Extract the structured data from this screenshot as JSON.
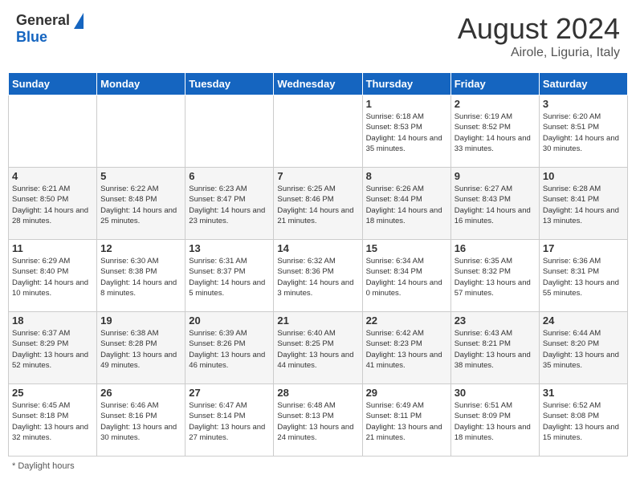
{
  "header": {
    "logo_general": "General",
    "logo_blue": "Blue",
    "month_year": "August 2024",
    "location": "Airole, Liguria, Italy"
  },
  "days_of_week": [
    "Sunday",
    "Monday",
    "Tuesday",
    "Wednesday",
    "Thursday",
    "Friday",
    "Saturday"
  ],
  "weeks": [
    [
      {
        "day": "",
        "info": ""
      },
      {
        "day": "",
        "info": ""
      },
      {
        "day": "",
        "info": ""
      },
      {
        "day": "",
        "info": ""
      },
      {
        "day": "1",
        "info": "Sunrise: 6:18 AM\nSunset: 8:53 PM\nDaylight: 14 hours and 35 minutes."
      },
      {
        "day": "2",
        "info": "Sunrise: 6:19 AM\nSunset: 8:52 PM\nDaylight: 14 hours and 33 minutes."
      },
      {
        "day": "3",
        "info": "Sunrise: 6:20 AM\nSunset: 8:51 PM\nDaylight: 14 hours and 30 minutes."
      }
    ],
    [
      {
        "day": "4",
        "info": "Sunrise: 6:21 AM\nSunset: 8:50 PM\nDaylight: 14 hours and 28 minutes."
      },
      {
        "day": "5",
        "info": "Sunrise: 6:22 AM\nSunset: 8:48 PM\nDaylight: 14 hours and 25 minutes."
      },
      {
        "day": "6",
        "info": "Sunrise: 6:23 AM\nSunset: 8:47 PM\nDaylight: 14 hours and 23 minutes."
      },
      {
        "day": "7",
        "info": "Sunrise: 6:25 AM\nSunset: 8:46 PM\nDaylight: 14 hours and 21 minutes."
      },
      {
        "day": "8",
        "info": "Sunrise: 6:26 AM\nSunset: 8:44 PM\nDaylight: 14 hours and 18 minutes."
      },
      {
        "day": "9",
        "info": "Sunrise: 6:27 AM\nSunset: 8:43 PM\nDaylight: 14 hours and 16 minutes."
      },
      {
        "day": "10",
        "info": "Sunrise: 6:28 AM\nSunset: 8:41 PM\nDaylight: 14 hours and 13 minutes."
      }
    ],
    [
      {
        "day": "11",
        "info": "Sunrise: 6:29 AM\nSunset: 8:40 PM\nDaylight: 14 hours and 10 minutes."
      },
      {
        "day": "12",
        "info": "Sunrise: 6:30 AM\nSunset: 8:38 PM\nDaylight: 14 hours and 8 minutes."
      },
      {
        "day": "13",
        "info": "Sunrise: 6:31 AM\nSunset: 8:37 PM\nDaylight: 14 hours and 5 minutes."
      },
      {
        "day": "14",
        "info": "Sunrise: 6:32 AM\nSunset: 8:36 PM\nDaylight: 14 hours and 3 minutes."
      },
      {
        "day": "15",
        "info": "Sunrise: 6:34 AM\nSunset: 8:34 PM\nDaylight: 14 hours and 0 minutes."
      },
      {
        "day": "16",
        "info": "Sunrise: 6:35 AM\nSunset: 8:32 PM\nDaylight: 13 hours and 57 minutes."
      },
      {
        "day": "17",
        "info": "Sunrise: 6:36 AM\nSunset: 8:31 PM\nDaylight: 13 hours and 55 minutes."
      }
    ],
    [
      {
        "day": "18",
        "info": "Sunrise: 6:37 AM\nSunset: 8:29 PM\nDaylight: 13 hours and 52 minutes."
      },
      {
        "day": "19",
        "info": "Sunrise: 6:38 AM\nSunset: 8:28 PM\nDaylight: 13 hours and 49 minutes."
      },
      {
        "day": "20",
        "info": "Sunrise: 6:39 AM\nSunset: 8:26 PM\nDaylight: 13 hours and 46 minutes."
      },
      {
        "day": "21",
        "info": "Sunrise: 6:40 AM\nSunset: 8:25 PM\nDaylight: 13 hours and 44 minutes."
      },
      {
        "day": "22",
        "info": "Sunrise: 6:42 AM\nSunset: 8:23 PM\nDaylight: 13 hours and 41 minutes."
      },
      {
        "day": "23",
        "info": "Sunrise: 6:43 AM\nSunset: 8:21 PM\nDaylight: 13 hours and 38 minutes."
      },
      {
        "day": "24",
        "info": "Sunrise: 6:44 AM\nSunset: 8:20 PM\nDaylight: 13 hours and 35 minutes."
      }
    ],
    [
      {
        "day": "25",
        "info": "Sunrise: 6:45 AM\nSunset: 8:18 PM\nDaylight: 13 hours and 32 minutes."
      },
      {
        "day": "26",
        "info": "Sunrise: 6:46 AM\nSunset: 8:16 PM\nDaylight: 13 hours and 30 minutes."
      },
      {
        "day": "27",
        "info": "Sunrise: 6:47 AM\nSunset: 8:14 PM\nDaylight: 13 hours and 27 minutes."
      },
      {
        "day": "28",
        "info": "Sunrise: 6:48 AM\nSunset: 8:13 PM\nDaylight: 13 hours and 24 minutes."
      },
      {
        "day": "29",
        "info": "Sunrise: 6:49 AM\nSunset: 8:11 PM\nDaylight: 13 hours and 21 minutes."
      },
      {
        "day": "30",
        "info": "Sunrise: 6:51 AM\nSunset: 8:09 PM\nDaylight: 13 hours and 18 minutes."
      },
      {
        "day": "31",
        "info": "Sunrise: 6:52 AM\nSunset: 8:08 PM\nDaylight: 13 hours and 15 minutes."
      }
    ]
  ],
  "footer": {
    "note": "Daylight hours"
  }
}
